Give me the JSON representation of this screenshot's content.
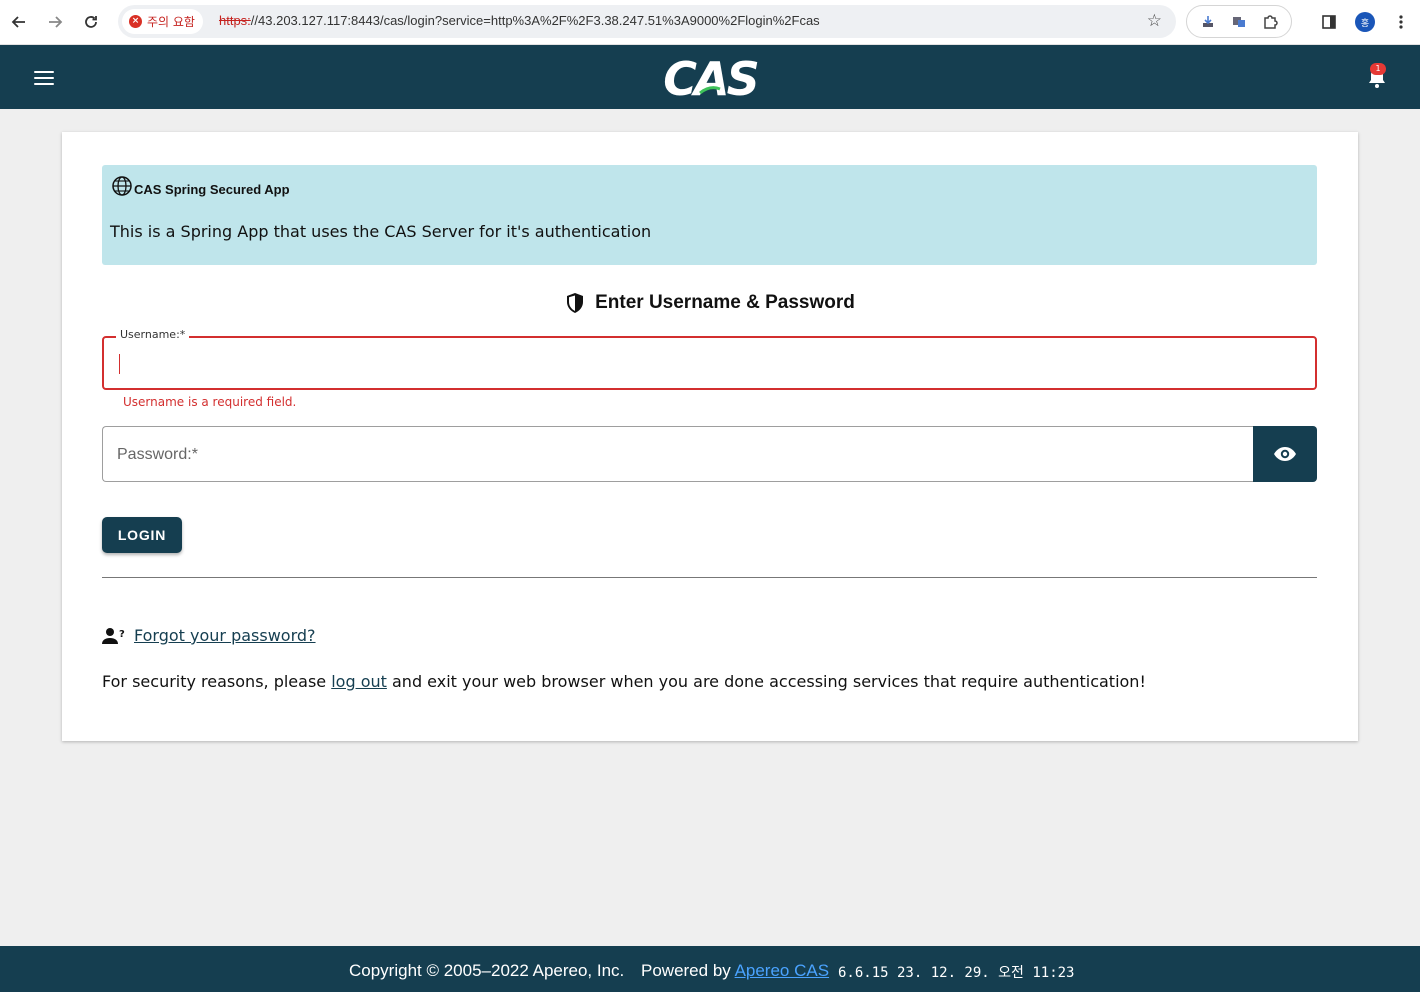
{
  "browser": {
    "security_chip": "주의 요함",
    "url_scheme": "https:",
    "url_rest": "//43.203.127.117:8443/cas/login?service=http%3A%2F%2F3.38.247.51%3A9000%2Flogin%2Fcas",
    "profile_initial": "홍"
  },
  "header": {
    "logo_text": "CAS",
    "notification_count": "1"
  },
  "banner": {
    "title": "CAS Spring Secured App",
    "description": "This is a Spring App that uses the CAS Server for it's authentication"
  },
  "form": {
    "heading": "Enter Username & Password",
    "username_label": "Username:*",
    "username_value": "",
    "username_error": "Username is a required field.",
    "password_placeholder": "Password:*",
    "login_label": "LOGIN"
  },
  "links": {
    "forgot_password": "Forgot your password?",
    "security_prefix": "For security reasons, please ",
    "logout": "log out",
    "security_suffix": " and exit your web browser when you are done accessing services that require authentication!"
  },
  "footer": {
    "copyright": "Copyright © 2005–2022 Apereo, Inc.",
    "powered_prefix": "Powered by ",
    "powered_link": "Apereo CAS",
    "version": "6.6.15 23. 12. 29. 오전 11:23"
  },
  "colors": {
    "brand": "#153e50",
    "error": "#d32f2f",
    "banner_bg": "#bfe5eb"
  }
}
